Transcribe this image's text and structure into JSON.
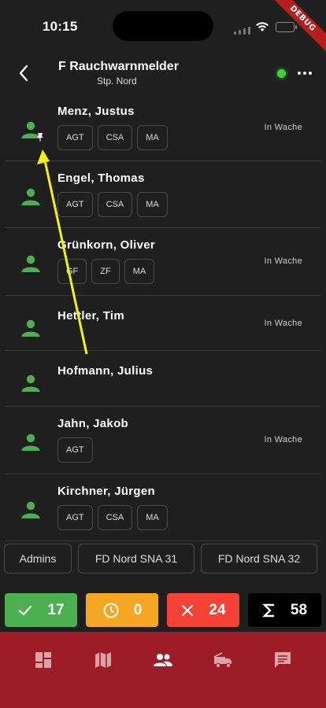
{
  "status_bar": {
    "time": "10:15",
    "debug": "DEBUG"
  },
  "header": {
    "title": "F Rauchwarnmelder",
    "subtitle": "Stp. Nord"
  },
  "members": [
    {
      "name": "Menz, Justus",
      "status": "In Wache",
      "tags": [
        "AGT",
        "CSA",
        "MA"
      ],
      "pinned": true
    },
    {
      "name": "Engel, Thomas",
      "status": "",
      "tags": [
        "AGT",
        "CSA",
        "MA"
      ]
    },
    {
      "name": "Grünkorn, Oliver",
      "status": "In Wache",
      "tags": [
        "GF",
        "ZF",
        "MA"
      ]
    },
    {
      "name": "Hettler, Tim",
      "status": "In Wache",
      "tags": []
    },
    {
      "name": "Hofmann, Julius",
      "status": "",
      "tags": []
    },
    {
      "name": "Jahn, Jakob",
      "status": "In Wache",
      "tags": [
        "AGT"
      ]
    },
    {
      "name": "Kirchner, Jürgen",
      "status": "",
      "tags": [
        "AGT",
        "CSA",
        "MA"
      ]
    }
  ],
  "groups": [
    "Admins",
    "FD Nord SNA 31",
    "FD Nord SNA 32"
  ],
  "counters": {
    "accepted": "17",
    "pending": "0",
    "declined": "24",
    "total": "58"
  },
  "colors": {
    "accepted": "#4caf50",
    "pending": "#f5a623",
    "declined": "#f44336",
    "total": "#000000",
    "person_icon": "#4caf50",
    "nav_bar": "#9c1c27",
    "annotation_arrow": "#f2f20d"
  },
  "nav": [
    "dashboard-icon",
    "map-icon",
    "people-icon",
    "fire-truck-icon",
    "chat-icon"
  ]
}
